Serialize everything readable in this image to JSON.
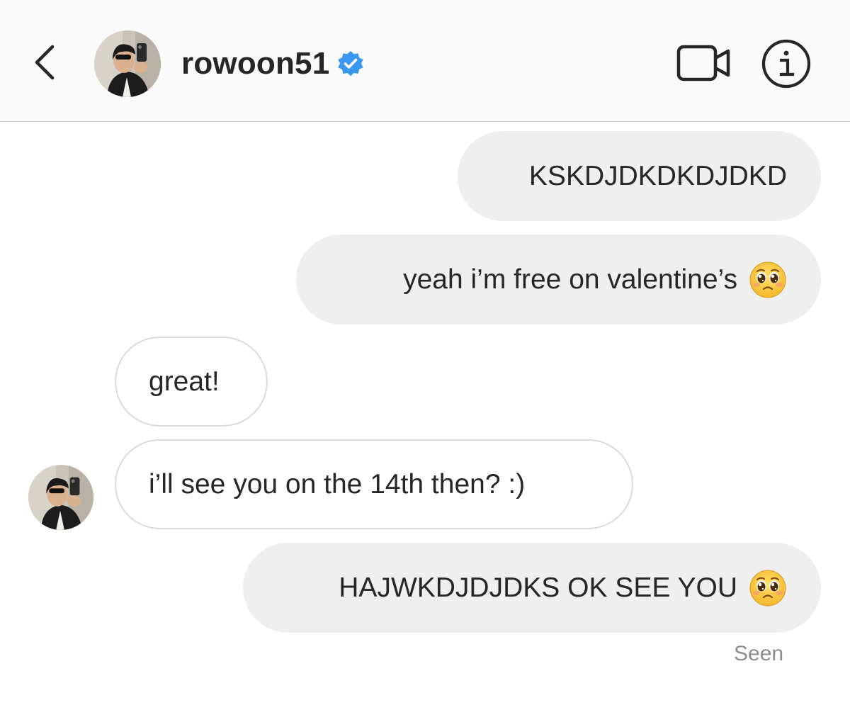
{
  "header": {
    "username": "rowoon51",
    "verified": true,
    "icons": [
      "back-chevron-icon",
      "verified-badge-icon",
      "video-call-icon",
      "info-icon"
    ],
    "colors": {
      "header_bg": "#fafafa",
      "verified_blue": "#3897f0",
      "text": "#262626",
      "muted": "#8e8e8e"
    }
  },
  "messages": [
    {
      "sender": "me",
      "text": "KSKDJDKDKDJDKD",
      "emoji": ""
    },
    {
      "sender": "me",
      "text": "yeah i’m free on valentine’s",
      "emoji": "pleading-face"
    },
    {
      "sender": "them",
      "text": "great!",
      "emoji": ""
    },
    {
      "sender": "them",
      "text": "i’ll see you on the 14th then? :)",
      "emoji": ""
    },
    {
      "sender": "me",
      "text": "HAJWKDJDJDKS OK SEE YOU",
      "emoji": "pleading-face"
    }
  ],
  "status": {
    "seen_label": "Seen"
  }
}
